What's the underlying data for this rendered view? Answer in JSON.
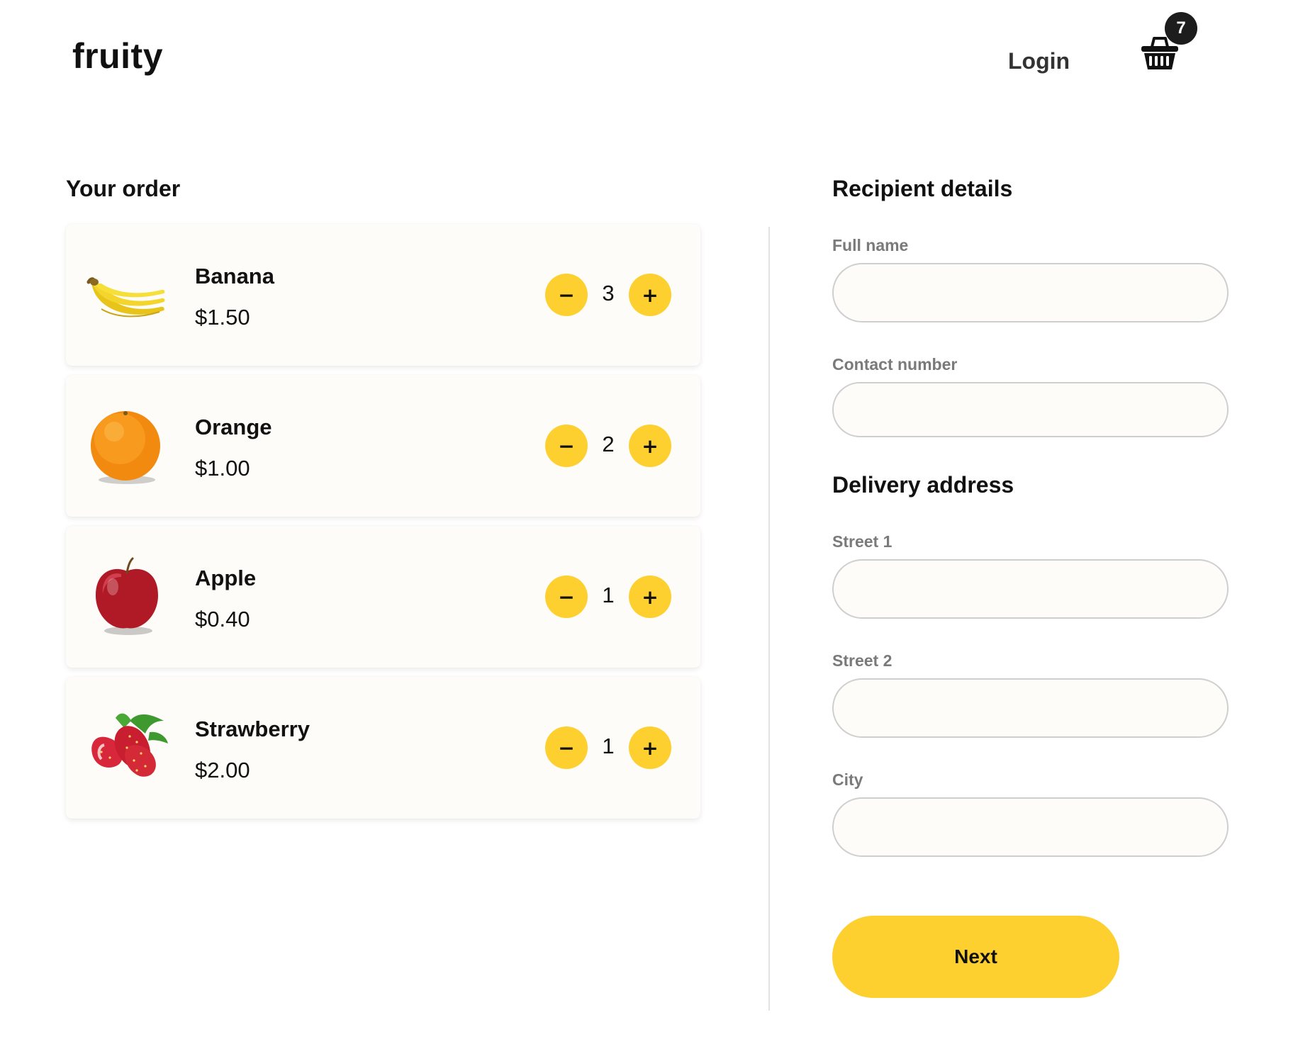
{
  "header": {
    "logo": "fruity",
    "login_label": "Login",
    "cart_icon": "basket-icon",
    "cart_count": "7"
  },
  "order": {
    "title": "Your order",
    "items": [
      {
        "name": "Banana",
        "price": "$1.50",
        "quantity": "3",
        "image": "banana-image"
      },
      {
        "name": "Orange",
        "price": "$1.00",
        "quantity": "2",
        "image": "orange-image"
      },
      {
        "name": "Apple",
        "price": "$0.40",
        "quantity": "1",
        "image": "apple-image"
      },
      {
        "name": "Strawberry",
        "price": "$2.00",
        "quantity": "1",
        "image": "strawberry-image"
      }
    ],
    "minus_label": "−",
    "plus_label": "+"
  },
  "recipient": {
    "title": "Recipient details",
    "full_name_label": "Full name",
    "full_name_value": "",
    "contact_label": "Contact number",
    "contact_value": ""
  },
  "delivery": {
    "title": "Delivery address",
    "street1_label": "Street 1",
    "street1_value": "",
    "street2_label": "Street 2",
    "street2_value": "",
    "city_label": "City",
    "city_value": ""
  },
  "actions": {
    "next_label": "Next"
  },
  "colors": {
    "accent": "#fdcf2f",
    "card_bg": "#fdfcf8",
    "badge_bg": "#1d1d1d",
    "label_gray": "#7a7a7a"
  }
}
